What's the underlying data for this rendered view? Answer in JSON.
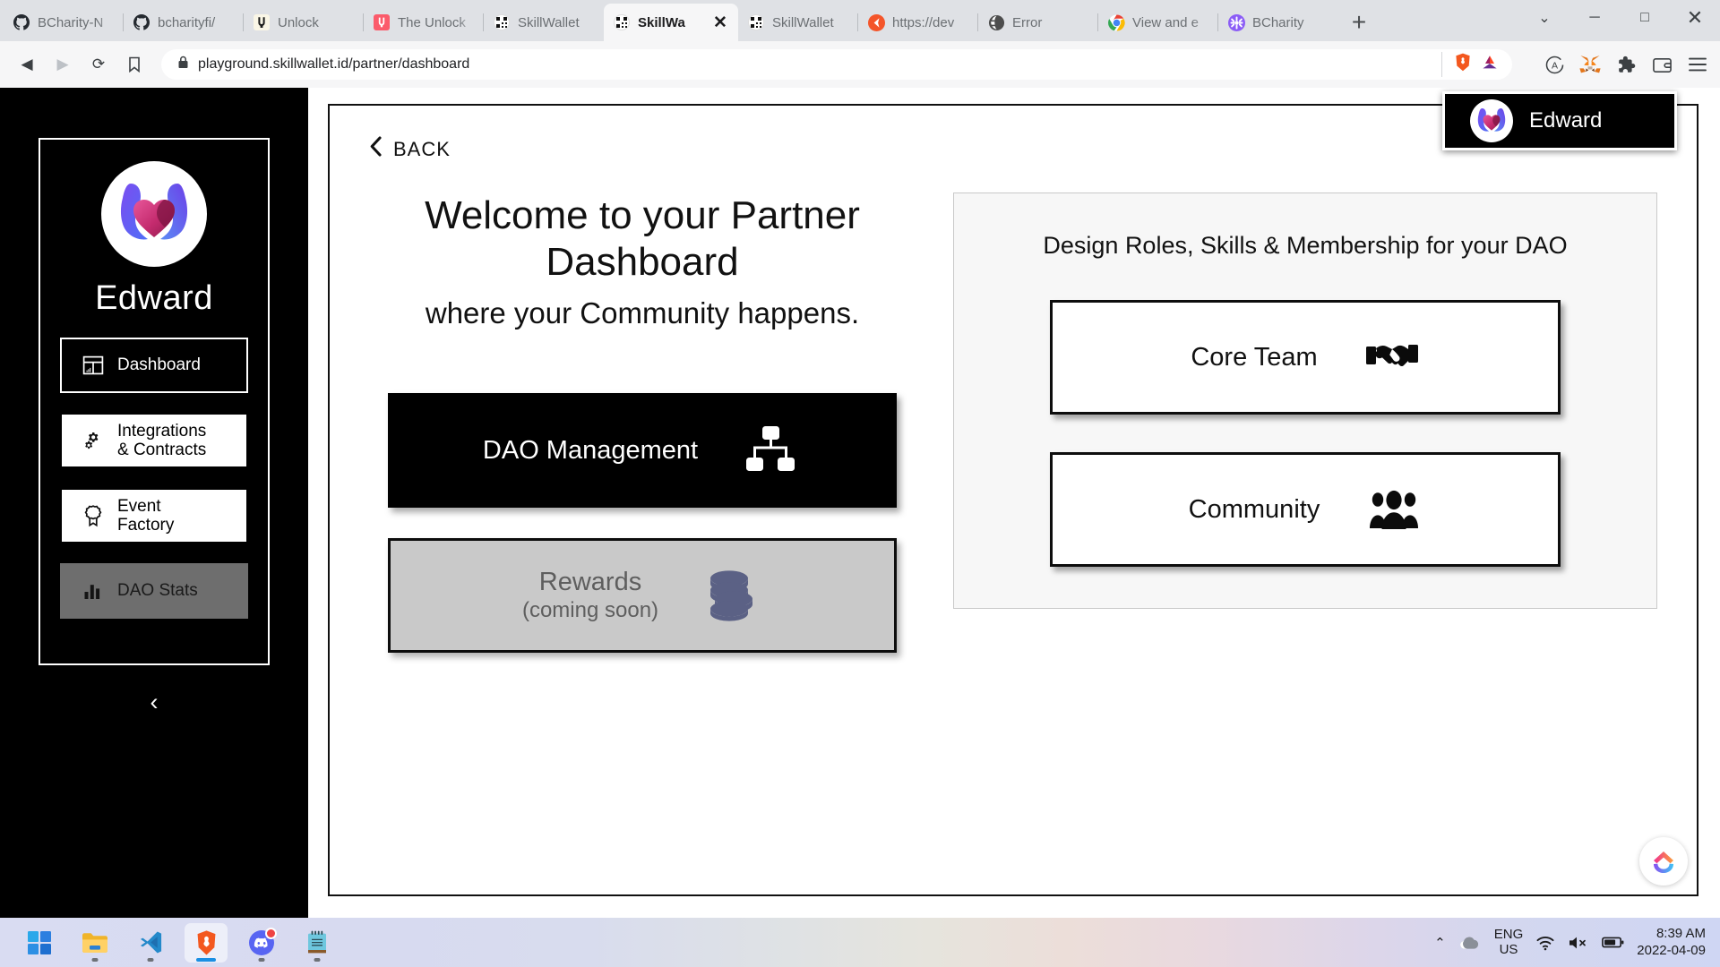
{
  "browser": {
    "tabs": [
      {
        "title": "BCharity-N",
        "favicon": "github-icon",
        "active": false
      },
      {
        "title": "bcharityfi/",
        "favicon": "github-icon",
        "active": false
      },
      {
        "title": "Unlock",
        "favicon": "unlock-light-icon",
        "active": false
      },
      {
        "title": "The Unlock",
        "favicon": "unlock-red-icon",
        "active": false
      },
      {
        "title": "SkillWallet",
        "favicon": "skillwallet-icon",
        "active": false
      },
      {
        "title": "SkillWa",
        "favicon": "skillwallet-icon",
        "active": true
      },
      {
        "title": "SkillWallet",
        "favicon": "skillwallet-icon",
        "active": false
      },
      {
        "title": "https://dev",
        "favicon": "orange-swirl-icon",
        "active": false
      },
      {
        "title": "Error",
        "favicon": "globe-dark-icon",
        "active": false
      },
      {
        "title": "View and e",
        "favicon": "chrome-icon",
        "active": false
      },
      {
        "title": "BCharity",
        "favicon": "bcharity-purple-icon",
        "active": false
      }
    ],
    "newtab_label": "+",
    "close_tab_label": "✕",
    "window_controls": {
      "minimize": "─",
      "maximize": "□",
      "close": "✕",
      "tablist": "⌄"
    },
    "nav": {
      "back": "◀",
      "forward": "▶",
      "reload": "⟳",
      "bookmark": "bookmark-icon"
    },
    "address": {
      "url": "playground.skillwallet.id/partner/dashboard",
      "lock": "lock-icon"
    },
    "omni_right_icons": [
      "brave-shield-icon",
      "bat-token-icon"
    ],
    "toolbar_icons": [
      "adblock-icon",
      "metamask-icon",
      "extensions-puzzle-icon",
      "wallet-icon",
      "browser-menu-icon"
    ]
  },
  "sidebar": {
    "profile_name": "Edward",
    "logo": "bcharity-heart-hands-logo",
    "items": [
      {
        "label": "Dashboard",
        "icon": "dashboard-grid-icon",
        "state": "active",
        "multiline": false
      },
      {
        "label": "Integrations\n& Contracts",
        "icon": "gears-icon",
        "state": "plain",
        "multiline": true
      },
      {
        "label": "Event\nFactory",
        "icon": "badge-ribbon-icon",
        "state": "plain",
        "multiline": true
      },
      {
        "label": "DAO Stats",
        "icon": "bar-chart-icon",
        "state": "muted",
        "multiline": false
      }
    ],
    "collapse_label": "‹"
  },
  "main": {
    "back_label": "BACK",
    "back_icon": "chevron-left-icon",
    "user_badge": {
      "name": "Edward",
      "avatar": "bcharity-heart-hands-logo"
    },
    "welcome_title": "Welcome to your Partner Dashboard",
    "welcome_subtitle": "where your Community happens.",
    "primary_buttons": [
      {
        "label": "DAO Management",
        "sub": "",
        "icon": "org-chart-icon",
        "style": "dark"
      },
      {
        "label": "Rewards",
        "sub": "(coming soon)",
        "icon": "coin-stack-icon",
        "style": "gray"
      }
    ],
    "right_card": {
      "title": "Design Roles, Skills & Membership for your DAO",
      "options": [
        {
          "label": "Core Team",
          "icon": "handshake-icon"
        },
        {
          "label": "Community",
          "icon": "people-group-icon"
        }
      ]
    },
    "float_logo": "skillwallet-chevron-logo"
  },
  "taskbar": {
    "apps": [
      {
        "name": "windows-start-icon",
        "active": false,
        "indicator": "none"
      },
      {
        "name": "file-explorer-icon",
        "active": false,
        "indicator": "none"
      },
      {
        "name": "vscode-icon",
        "active": false,
        "indicator": "dot"
      },
      {
        "name": "brave-browser-icon",
        "active": true,
        "indicator": "wide"
      },
      {
        "name": "discord-icon",
        "active": false,
        "indicator": "dot"
      },
      {
        "name": "notepad-icon",
        "active": false,
        "indicator": "dot"
      }
    ],
    "tray": {
      "chevron": "⌃",
      "cloud_icon": "onedrive-cloud-icon",
      "language_line1": "ENG",
      "language_line2": "US",
      "wifi_icon": "wifi-icon",
      "volume_icon": "volume-muted-icon",
      "battery_icon": "battery-icon",
      "time": "8:39 AM",
      "date": "2022-04-09"
    }
  },
  "colors": {
    "accent_black": "#000000",
    "muted_gray": "#6e6e6e",
    "rewards_bg": "#c9c9c9",
    "rewards_text": "#5e5e5e",
    "coin_slate": "#5b6185",
    "card_bg": "#f7f7f7"
  }
}
